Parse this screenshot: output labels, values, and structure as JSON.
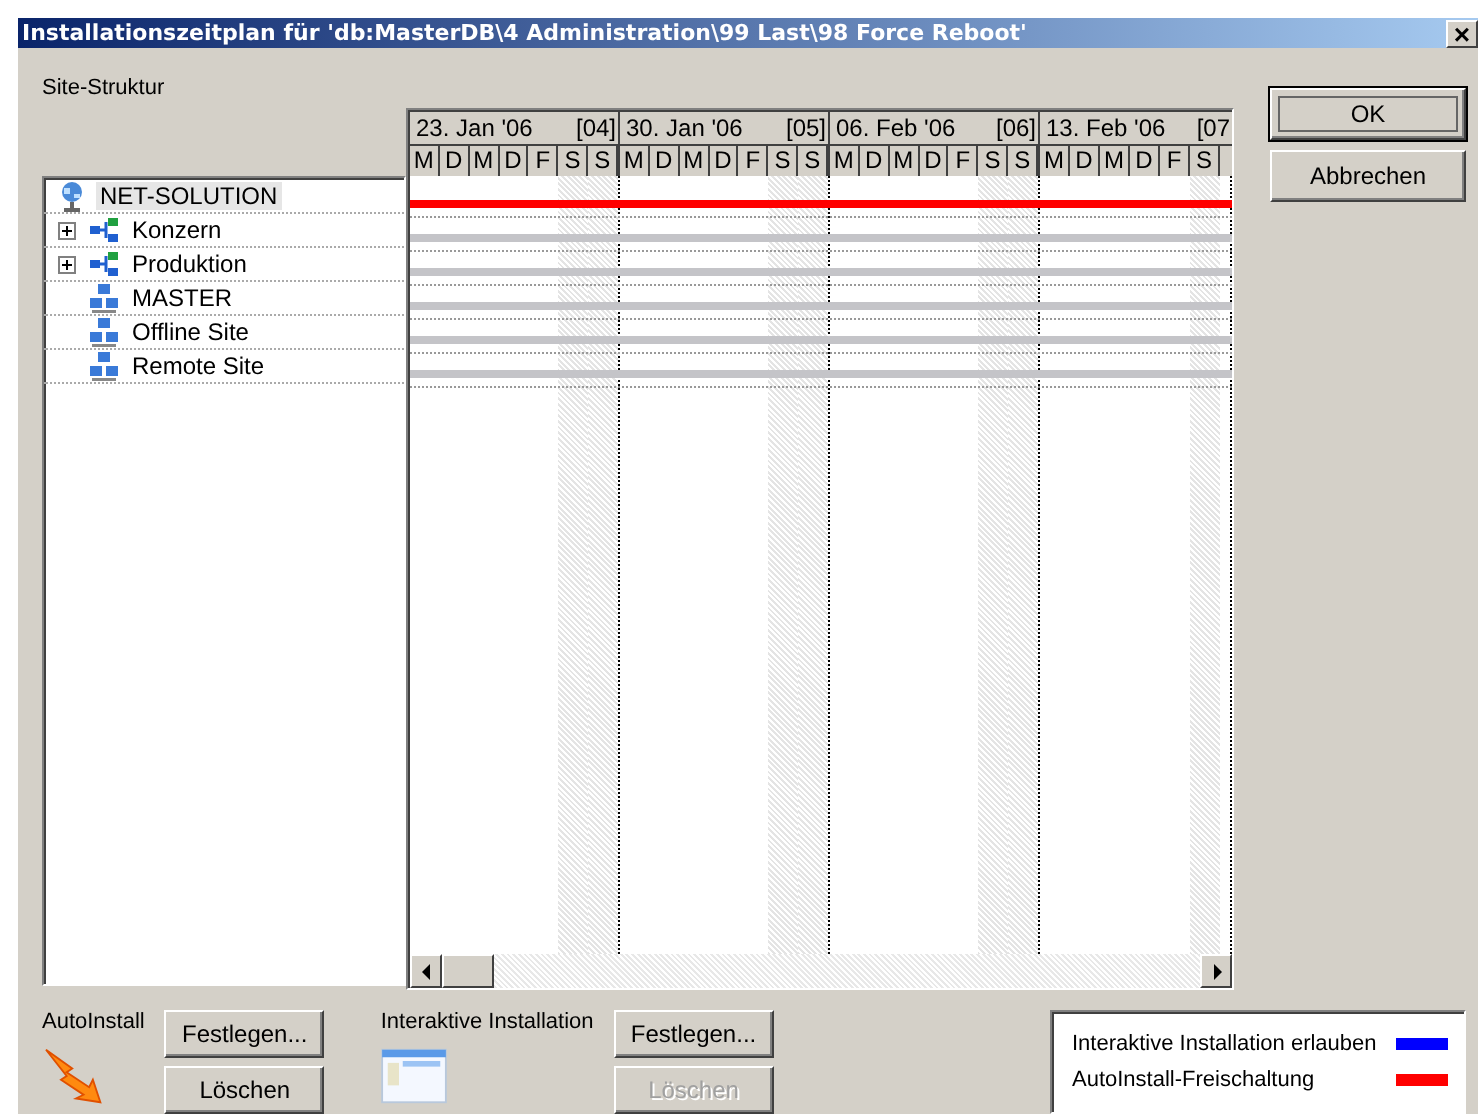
{
  "window": {
    "title": "Installationszeitplan für 'db:MasterDB\\4 Administration\\99 Last\\98 Force Reboot'",
    "close": "×"
  },
  "site_tree": {
    "label": "Site-Struktur",
    "items": [
      {
        "label": "NET-SOLUTION",
        "kind": "root",
        "selected": true,
        "children": [
          {
            "label": "Konzern",
            "kind": "group",
            "selected": false,
            "expanded": false
          },
          {
            "label": "Produktion",
            "kind": "group",
            "selected": false,
            "expanded": false
          },
          {
            "label": "MASTER",
            "kind": "site",
            "selected": false
          },
          {
            "label": "Offline Site",
            "kind": "site",
            "selected": false
          },
          {
            "label": "Remote Site",
            "kind": "site",
            "selected": false
          }
        ]
      }
    ]
  },
  "schedule": {
    "weeks": [
      {
        "date": "23. Jan '06",
        "week": "[04]",
        "days": [
          {
            "label": "M",
            "weekend": false
          },
          {
            "label": "D",
            "weekend": false
          },
          {
            "label": "M",
            "weekend": false
          },
          {
            "label": "D",
            "weekend": false
          },
          {
            "label": "F",
            "weekend": false
          },
          {
            "label": "S",
            "weekend": true
          },
          {
            "label": "S",
            "weekend": true
          }
        ]
      },
      {
        "date": "30. Jan '06",
        "week": "[05]",
        "days": [
          {
            "label": "M",
            "weekend": false
          },
          {
            "label": "D",
            "weekend": false
          },
          {
            "label": "M",
            "weekend": false
          },
          {
            "label": "D",
            "weekend": false
          },
          {
            "label": "F",
            "weekend": false
          },
          {
            "label": "S",
            "weekend": true
          },
          {
            "label": "S",
            "weekend": true
          }
        ]
      },
      {
        "date": "06. Feb '06",
        "week": "[06]",
        "days": [
          {
            "label": "M",
            "weekend": false
          },
          {
            "label": "D",
            "weekend": false
          },
          {
            "label": "M",
            "weekend": false
          },
          {
            "label": "D",
            "weekend": false
          },
          {
            "label": "F",
            "weekend": false
          },
          {
            "label": "S",
            "weekend": true
          },
          {
            "label": "S",
            "weekend": true
          }
        ]
      },
      {
        "date": "13. Feb '06",
        "week": "[07",
        "days": [
          {
            "label": "M",
            "weekend": false
          },
          {
            "label": "D",
            "weekend": false
          },
          {
            "label": "M",
            "weekend": false
          },
          {
            "label": "D",
            "weekend": false
          },
          {
            "label": "F",
            "weekend": false
          },
          {
            "label": "S",
            "weekend": true
          }
        ]
      }
    ],
    "rows": [
      {
        "color": "#ff0000"
      },
      {
        "color": "#c4c4c8"
      },
      {
        "color": "#c4c4c8"
      },
      {
        "color": "#c4c4c8"
      },
      {
        "color": "#c4c4c8"
      },
      {
        "color": "#c4c4c8"
      }
    ]
  },
  "buttons": [
    {
      "label": "OK",
      "default": true
    },
    {
      "label": "Abbrechen",
      "default": false
    }
  ],
  "autoinstall": {
    "label": "AutoInstall",
    "buttons": [
      {
        "label": "Festlegen...",
        "disabled": false
      },
      {
        "label": "Löschen",
        "disabled": false
      }
    ]
  },
  "interactive": {
    "label": "Interaktive Installation",
    "buttons": [
      {
        "label": "Festlegen...",
        "disabled": false
      },
      {
        "label": "Löschen",
        "disabled": true
      }
    ]
  },
  "legend": [
    {
      "label": "Interaktive Installation erlauben",
      "color": "#0000ff"
    },
    {
      "label": "AutoInstall-Freischaltung",
      "color": "#ff0000"
    }
  ]
}
